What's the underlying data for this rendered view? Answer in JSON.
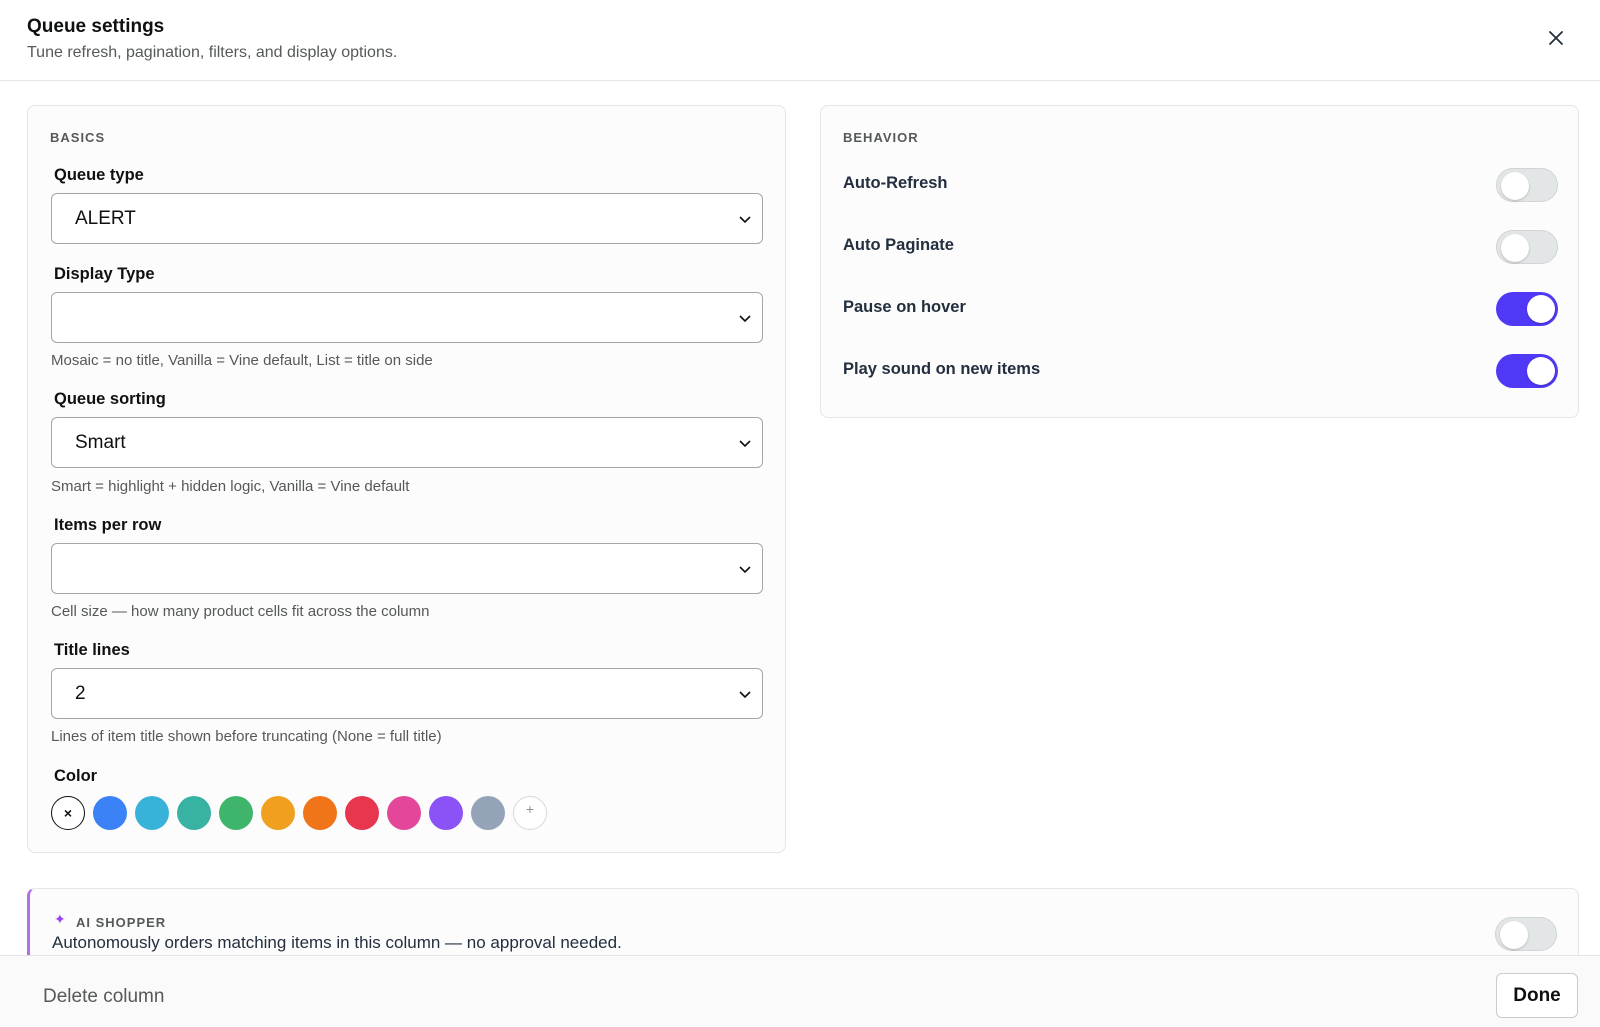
{
  "header": {
    "title": "Queue settings",
    "subtitle": "Tune refresh, pagination, filters, and display options."
  },
  "basics": {
    "section_label": "BASICS",
    "queue_type": {
      "label": "Queue type",
      "value": "ALERT"
    },
    "display_type": {
      "label": "Display Type",
      "value": "",
      "hint": "Mosaic = no title, Vanilla = Vine default, List = title on side"
    },
    "queue_sorting": {
      "label": "Queue sorting",
      "value": "Smart",
      "hint": "Smart = highlight + hidden logic, Vanilla = Vine default"
    },
    "items_per_row": {
      "label": "Items per row",
      "value": "",
      "hint": "Cell size — how many product cells fit across the column"
    },
    "title_lines": {
      "label": "Title lines",
      "value": "2",
      "hint": "Lines of item title shown before truncating (None = full title)"
    },
    "color": {
      "label": "Color",
      "none_glyph": "×",
      "add_glyph": "+",
      "swatches": [
        "#3b82f6",
        "#38b2d8",
        "#38b2a2",
        "#3fb56c",
        "#f0a01e",
        "#f07418",
        "#e8364f",
        "#e44699",
        "#8b52f5",
        "#94a3b8"
      ]
    }
  },
  "behavior": {
    "section_label": "BEHAVIOR",
    "toggles": [
      {
        "label": "Auto-Refresh",
        "on": false
      },
      {
        "label": "Auto Paginate",
        "on": false
      },
      {
        "label": "Pause on hover",
        "on": true
      },
      {
        "label": "Play sound on new items",
        "on": true
      }
    ]
  },
  "ai_shopper": {
    "label": "AI SHOPPER",
    "sparkle": "✦",
    "description": "Autonomously orders matching items in this column — no approval needed.",
    "on": false
  },
  "footer": {
    "delete_label": "Delete column",
    "done_label": "Done"
  },
  "colors": {
    "accent": "#4f39f6",
    "ai_border": "#b06ee8"
  }
}
